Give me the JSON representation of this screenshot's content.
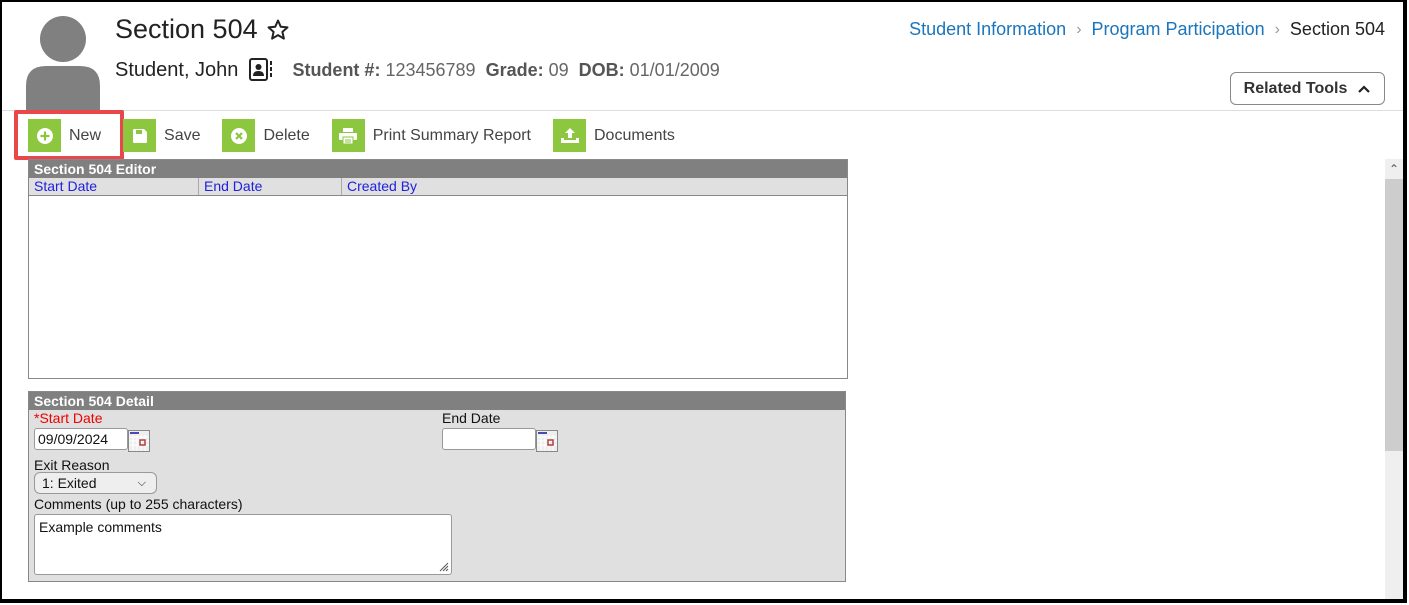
{
  "header": {
    "title": "Section 504",
    "student_name": "Student, John",
    "student_num_label": "Student #:",
    "student_num": "123456789",
    "grade_label": "Grade:",
    "grade": "09",
    "dob_label": "DOB:",
    "dob": "01/01/2009"
  },
  "breadcrumb": {
    "items": [
      "Student Information",
      "Program Participation"
    ],
    "current": "Section 504"
  },
  "related_tools": {
    "label": "Related Tools"
  },
  "toolbar": {
    "new": "New",
    "save": "Save",
    "delete": "Delete",
    "print": "Print Summary Report",
    "documents": "Documents"
  },
  "editor": {
    "title": "Section 504 Editor",
    "columns": [
      "Start Date",
      "End Date",
      "Created By"
    ],
    "rows": []
  },
  "detail": {
    "title": "Section 504 Detail",
    "start_date_label": "*Start Date",
    "start_date": "09/09/2024",
    "end_date_label": "End Date",
    "end_date": "",
    "exit_reason_label": "Exit Reason",
    "exit_reason": "1: Exited",
    "comments_label": "Comments (up to 255 characters)",
    "comments": "Example comments"
  },
  "colors": {
    "accent_green": "#8dc63f",
    "link_blue": "#1a75bc",
    "highlight_red": "#e8484c",
    "panel_gray": "#808080"
  }
}
